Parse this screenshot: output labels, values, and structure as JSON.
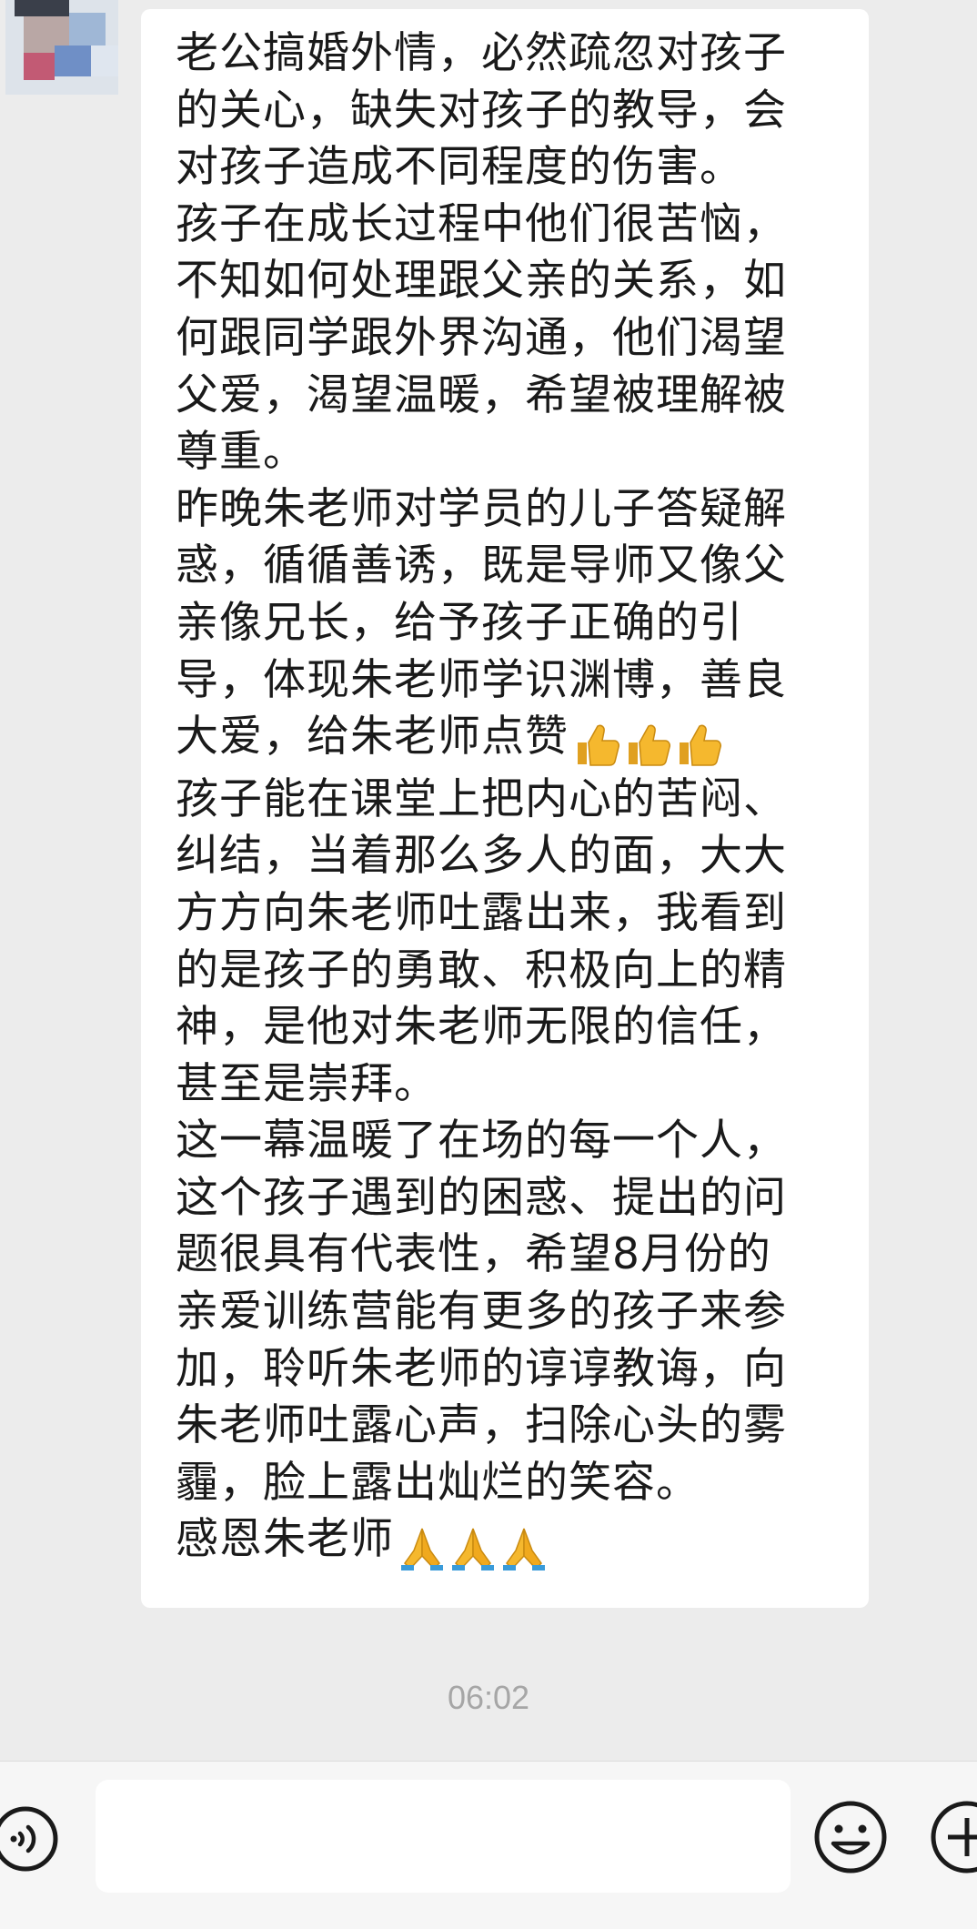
{
  "message": {
    "paragraphs": [
      "老公搞婚外情，必然疏忽对孩子\n的关心，缺失对孩子的教导，会\n对孩子造成不同程度的伤害。",
      "孩子在成长过程中他们很苦恼，\n不知如何处理跟父亲的关系，如\n何跟同学跟外界沟通，他们渴望\n父爱，渴望温暖，希望被理解被\n尊重。",
      "昨晚朱老师对学员的儿子答疑解\n惑，循循善诱，既是导师又像父\n亲像兄长，给予孩子正确的引\n导，体现朱老师学识渊博，善良\n大爱，给朱老师点赞",
      "孩子能在课堂上把内心的苦闷、\n纠结，当着那么多人的面，大大\n方方向朱老师吐露出来，我看到\n的是孩子的勇敢、积极向上的精\n神，是他对朱老师无限的信任，\n甚至是崇拜。",
      "这一幕温暖了在场的每一个人，\n这个孩子遇到的困惑、提出的问\n题很具有代表性，希望8月份的\n亲爱训练营能有更多的孩子来参\n加，聆听朱老师的谆谆教诲，向\n朱老师吐露心声，扫除心头的雾\n霾，脸上露出灿烂的笑容。",
      "感恩朱老师"
    ],
    "emoji_after_p3": [
      "thumbs-up-icon",
      "thumbs-up-icon",
      "thumbs-up-icon"
    ],
    "emoji_after_p6": [
      "folded-hands-icon",
      "folded-hands-icon",
      "folded-hands-icon"
    ]
  },
  "timestamp": "06:02",
  "input": {
    "value": ""
  },
  "colors": {
    "chat_bg": "#ececec",
    "bubble_bg": "#ffffff",
    "text": "#1a1a1a",
    "timestamp": "#a6a6a6",
    "emoji_yellow": "#f5b82e"
  }
}
